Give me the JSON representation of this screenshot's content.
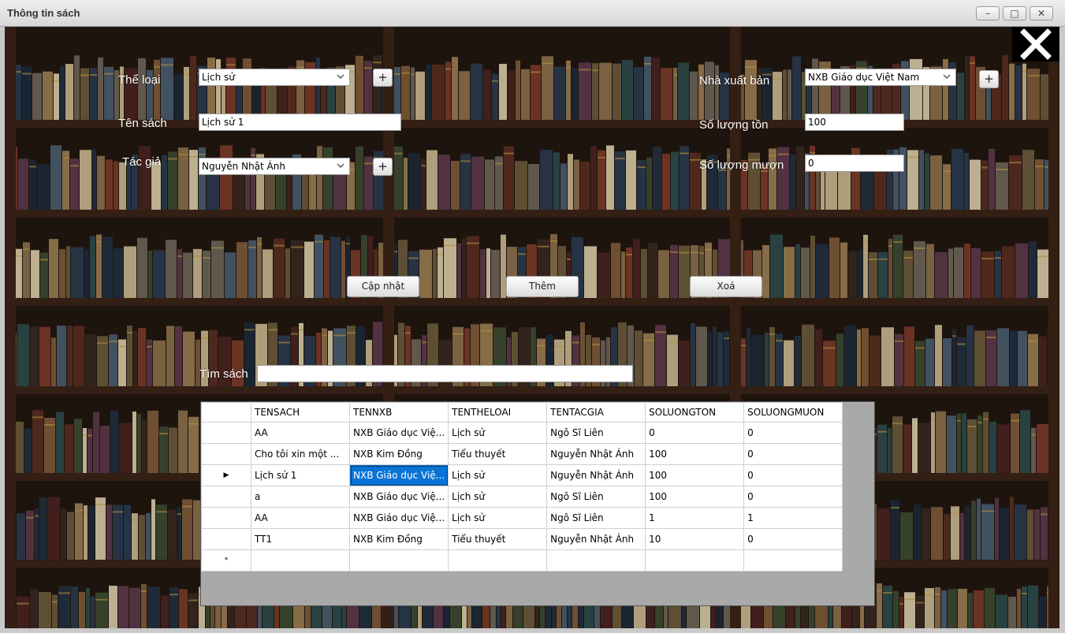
{
  "window": {
    "title": "Thông tin sách",
    "buttons": {
      "minimize": "–",
      "maximize": "□",
      "close": "✕"
    }
  },
  "form": {
    "the_loai": {
      "label": "Thể loại",
      "value": "Lịch sử",
      "add_label": "+"
    },
    "ten_sach": {
      "label": "Tên sách",
      "value": "Lịch sử 1"
    },
    "tac_gia": {
      "label": "Tác giả",
      "value": "Nguyễn Nhật Ánh",
      "add_label": "+"
    },
    "nha_xuat_ban": {
      "label": "Nhà xuất bản",
      "value": "NXB Giáo dục Việt Nam",
      "add_label": "+"
    },
    "so_luong_ton": {
      "label": "Số lượng tồn",
      "value": "100"
    },
    "so_luong_muon": {
      "label": "Số lượng mượn",
      "value": "0"
    }
  },
  "actions": {
    "update": "Cập nhật",
    "add": "Thêm",
    "delete": "Xoá"
  },
  "search": {
    "label": "Tìm sách",
    "value": ""
  },
  "close_icon": "close-x-icon",
  "grid": {
    "columns": [
      "TENSACH",
      "TENNXB",
      "TENTHELOAI",
      "TENTACGIA",
      "SOLUONGTON",
      "SOLUONGMUON"
    ],
    "rows": [
      [
        "AA",
        "NXB Giáo dục Việ...",
        "Lịch sử",
        "Ngô Sĩ Liên",
        "0",
        "0"
      ],
      [
        "Cho tôi xin một ...",
        "NXB Kim Đồng",
        "Tiểu thuyết",
        "Nguyễn Nhật Ánh",
        "100",
        "0"
      ],
      [
        "Lịch sử 1",
        "NXB Giáo dục Việ...",
        "Lịch sử",
        "Nguyễn Nhật Ánh",
        "100",
        "0"
      ],
      [
        "a",
        "NXB Giáo dục Việ...",
        "Lịch sử",
        "Ngô Sĩ Liên",
        "100",
        "0"
      ],
      [
        "AA",
        "NXB Giáo dục Việ...",
        "Lịch sử",
        "Ngô Sĩ Liên",
        "1",
        "1"
      ],
      [
        "TT1",
        "NXB Kim Đồng",
        "Tiểu thuyết",
        "Nguyễn Nhật Ánh",
        "10",
        "0"
      ]
    ],
    "current_row_marker": "▶",
    "new_row_marker": "*",
    "colors": {
      "selection": "#0a74d6"
    }
  }
}
